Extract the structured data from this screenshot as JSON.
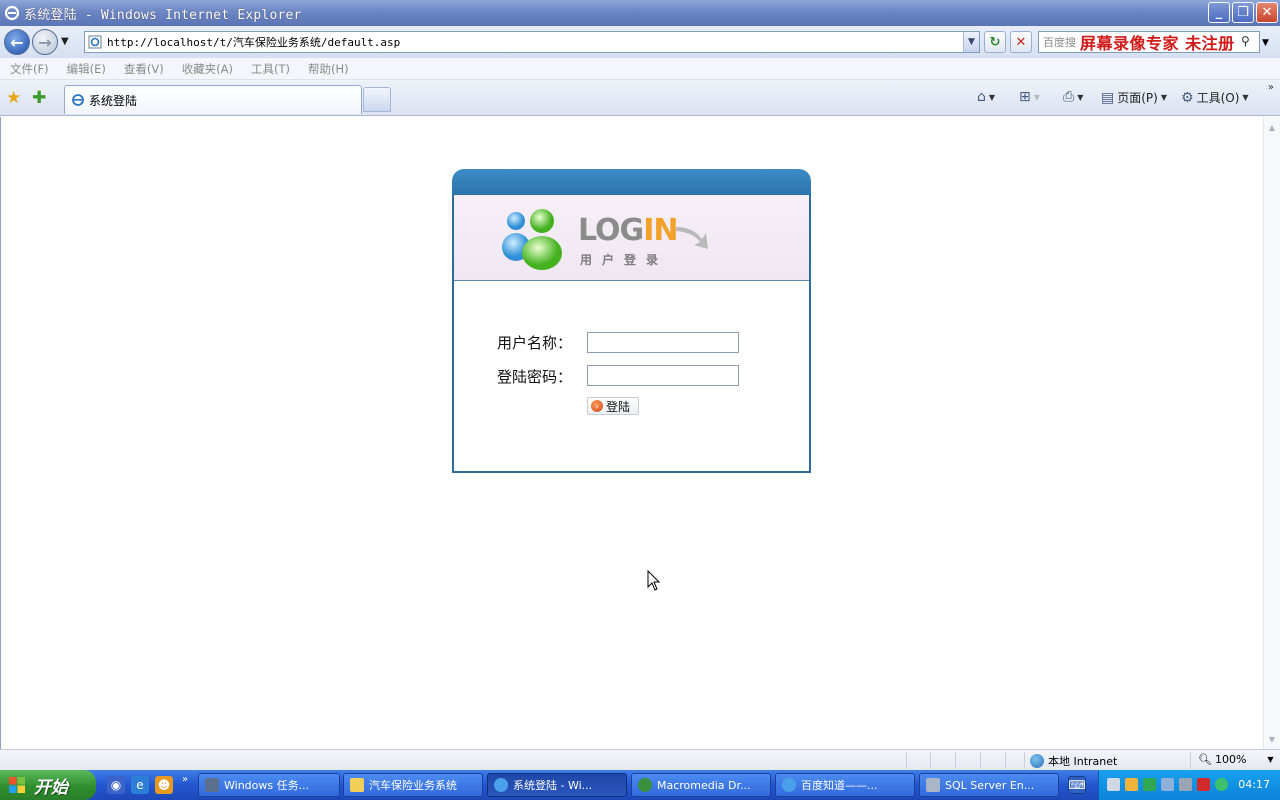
{
  "window": {
    "title": "系统登陆 - Windows Internet Explorer"
  },
  "address": {
    "url": "http://localhost/t/汽车保险业务系统/default.asp"
  },
  "search": {
    "placeholder": "百度搜"
  },
  "watermark": "屏幕录像专家 未注册",
  "menu": {
    "items": [
      "文件(F)",
      "编辑(E)",
      "查看(V)",
      "收藏夹(A)",
      "工具(T)",
      "帮助(H)"
    ]
  },
  "tab": {
    "label": "系统登陆"
  },
  "commands": {
    "page": "页面(P)",
    "tools": "工具(O)"
  },
  "login": {
    "logo_log": "LOG",
    "logo_in": "IN",
    "subtitle": "用户登录",
    "username_label": "用户名称：",
    "password_label": "登陆密码：",
    "username_value": "",
    "password_value": "",
    "submit_label": "登陆"
  },
  "status": {
    "zone": "本地 Intranet",
    "zoom": "100%"
  },
  "taskbar": {
    "start_label": "开始",
    "tasks": [
      "Windows 任务...",
      "汽车保险业务系统",
      "系统登陆 - Wi...",
      "Macromedia Dr...",
      "百度知道——...",
      "SQL Server En..."
    ],
    "clock": "04:17"
  },
  "colors": {
    "login_header": "#2a72aa",
    "login_border": "#2c6b9c",
    "logo_accent": "#f2a12b",
    "watermark": "#d21a1a"
  }
}
